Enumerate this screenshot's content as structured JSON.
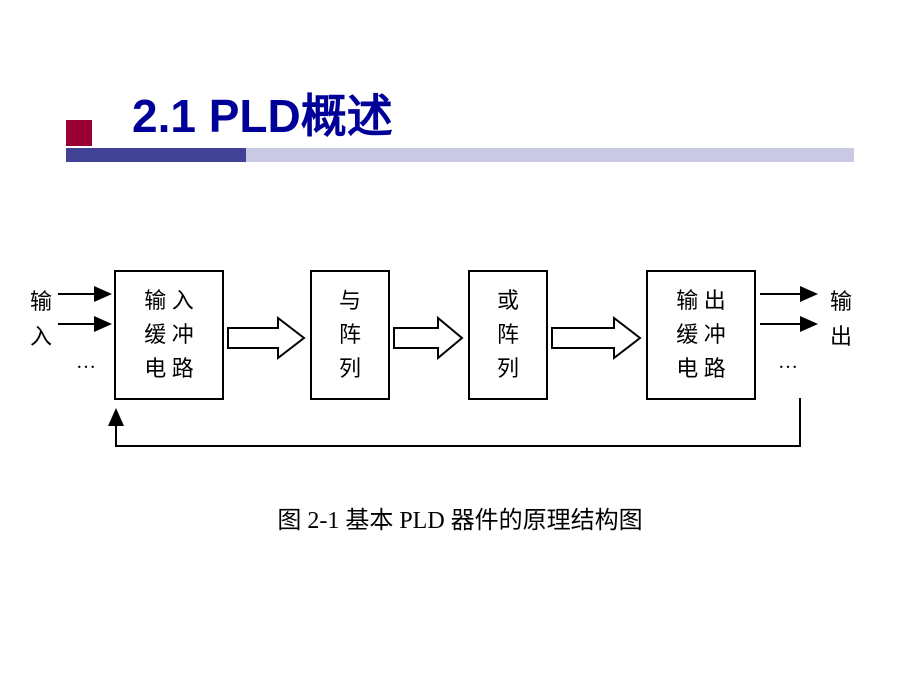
{
  "title": "2.1  PLD概述",
  "caption": "图 2-1   基本 PLD 器件的原理结构图",
  "io": {
    "input_label_1": "输",
    "input_label_2": "入",
    "output_label_1": "输",
    "output_label_2": "出",
    "ellipsis": "…"
  },
  "boxes": {
    "box1_l1": "输 入",
    "box1_l2": "缓 冲",
    "box1_l3": "电 路",
    "box2_l1": "与",
    "box2_l2": "阵",
    "box2_l3": "列",
    "box3_l1": "或",
    "box3_l2": "阵",
    "box3_l3": "列",
    "box4_l1": "输 出",
    "box4_l2": "缓 冲",
    "box4_l3": "电 路"
  },
  "colors": {
    "title": "#000099",
    "accent": "#990033",
    "underline_dark": "#414196",
    "underline_light": "#c9c9e3"
  }
}
